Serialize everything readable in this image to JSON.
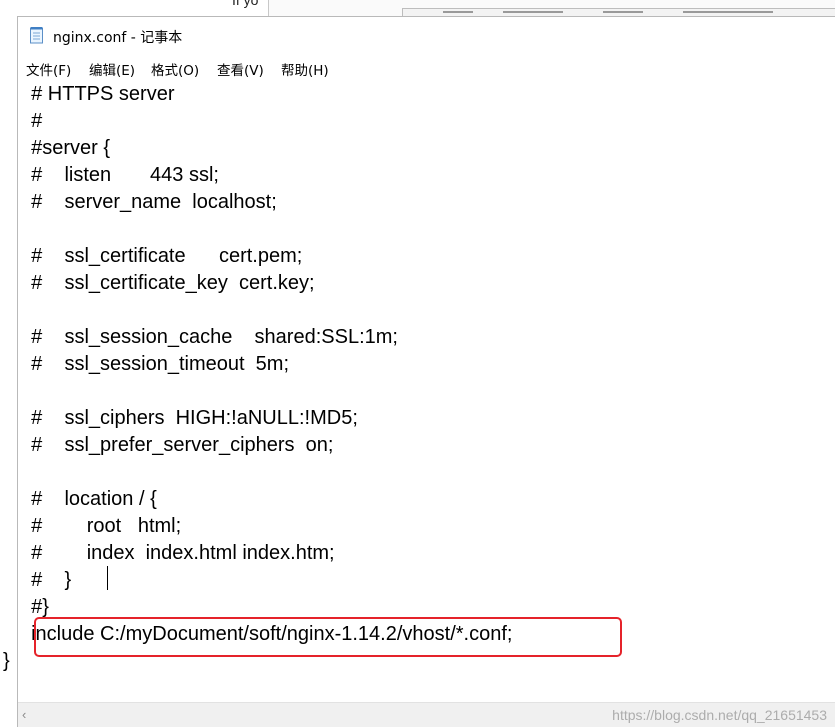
{
  "background": {
    "peek_text": "If yo"
  },
  "window": {
    "title": "nginx.conf - 记事本",
    "app_icon": "notepad-icon"
  },
  "menu": [
    {
      "label": "文件(F)"
    },
    {
      "label": "编辑(E)"
    },
    {
      "label": "格式(O)"
    },
    {
      "label": "查看(V)"
    },
    {
      "label": "帮助(H)"
    }
  ],
  "editor": {
    "lines": [
      "  # HTTPS server",
      "  #",
      "  #server {",
      "  #    listen       443 ssl;",
      "  #    server_name  localhost;",
      "",
      "  #    ssl_certificate      cert.pem;",
      "  #    ssl_certificate_key  cert.key;",
      "",
      "  #    ssl_session_cache    shared:SSL:1m;",
      "  #    ssl_session_timeout  5m;",
      "",
      "  #    ssl_ciphers  HIGH:!aNULL:!MD5;",
      "  #    ssl_prefer_server_ciphers  on;",
      "",
      "  #    location / {",
      "  #        root   html;",
      "  #        index  index.html index.htm;",
      "  #    }",
      "  #}",
      "  include C:/myDocument/soft/nginx-1.14.2/vhost/*.conf;",
      "}"
    ],
    "highlight_color": "#e5232a"
  },
  "scrollbar": {
    "left_arrow": "‹"
  },
  "watermark": "https://blog.csdn.net/qq_21651453"
}
